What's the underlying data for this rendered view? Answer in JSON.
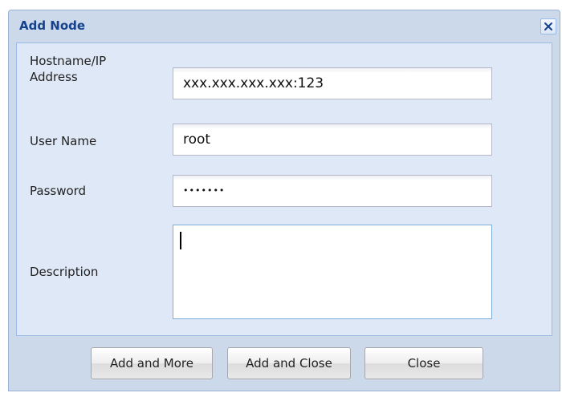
{
  "dialog": {
    "title": "Add Node",
    "close_icon": "close-icon"
  },
  "form": {
    "hostname_label": "Hostname/IP Address",
    "hostname_value": "xxx.xxx.xxx.xxx:123",
    "username_label": "User Name",
    "username_value": "root",
    "password_label": "Password",
    "password_value": "•••••••",
    "description_label": "Description",
    "description_value": ""
  },
  "buttons": {
    "add_more": "Add and More",
    "add_close": "Add and Close",
    "close": "Close"
  },
  "colors": {
    "title_text": "#15428b",
    "dialog_bg": "#ccd9ea",
    "panel_bg": "#dfe8f6"
  }
}
